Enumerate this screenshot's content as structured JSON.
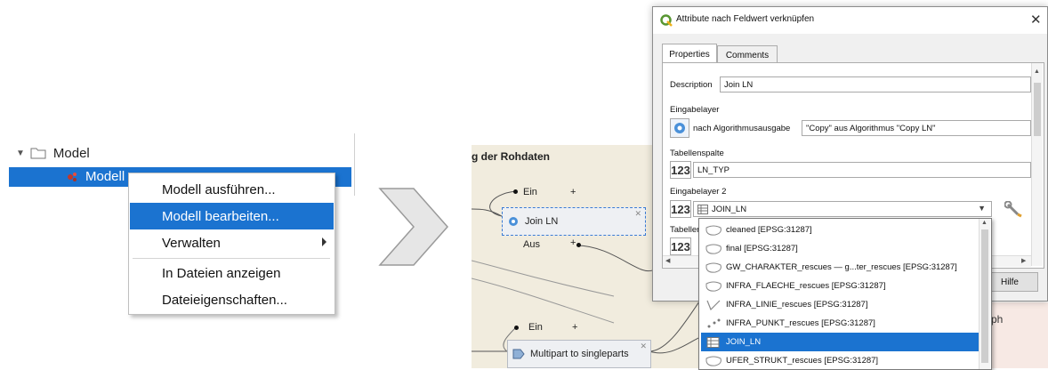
{
  "tree": {
    "root_label": "Model",
    "child_label": "Modell"
  },
  "context_menu": {
    "items": [
      {
        "label": "Modell ausführen..."
      },
      {
        "label": "Modell bearbeiten..."
      },
      {
        "label": "Verwalten"
      },
      {
        "label": "In Dateien anzeigen"
      },
      {
        "label": "Dateieigenschaften..."
      }
    ]
  },
  "canvas": {
    "group_title": "g der Rohdaten",
    "top_ein": "Ein",
    "top_join": "Join LN",
    "top_aus": "Aus",
    "bottom_ein": "Ein",
    "bottom_algo": "Multipart to singleparts",
    "side_text": "ph"
  },
  "dialog": {
    "title": "Attribute nach Feldwert verknüpfen",
    "tabs": [
      "Properties",
      "Comments"
    ],
    "description_label": "Description",
    "description_value": "Join LN",
    "eingabelayer_label": "Eingabelayer",
    "eingabelayer_mode": "nach Algorithmusausgabe",
    "eingabelayer_value": "\"Copy\" aus Algorithmus \"Copy LN\"",
    "tabellenspalte_label": "Tabellenspalte",
    "tabellenspalte_value": "LN_TYP",
    "eingabelayer2_label": "Eingabelayer 2",
    "eingabelayer2_value": "JOIN_LN",
    "tabelle_partial": "Tabeller",
    "num_badge": "123",
    "help_button": "Hilfe"
  },
  "dropdown": {
    "items": [
      {
        "label": "cleaned [EPSG:31287]",
        "icon": "polygon-icon"
      },
      {
        "label": "final [EPSG:31287]",
        "icon": "polygon-icon"
      },
      {
        "label": "GW_CHARAKTER_rescues — g...ter_rescues [EPSG:31287]",
        "icon": "polygon-icon"
      },
      {
        "label": "INFRA_FLAECHE_rescues [EPSG:31287]",
        "icon": "polygon-icon"
      },
      {
        "label": "INFRA_LINIE_rescues [EPSG:31287]",
        "icon": "line-icon"
      },
      {
        "label": "INFRA_PUNKT_rescues [EPSG:31287]",
        "icon": "point-icon"
      },
      {
        "label": "JOIN_LN",
        "icon": "table-icon",
        "selected": true
      },
      {
        "label": "UFER_STRUKT_rescues [EPSG:31287]",
        "icon": "polygon-icon"
      }
    ]
  }
}
